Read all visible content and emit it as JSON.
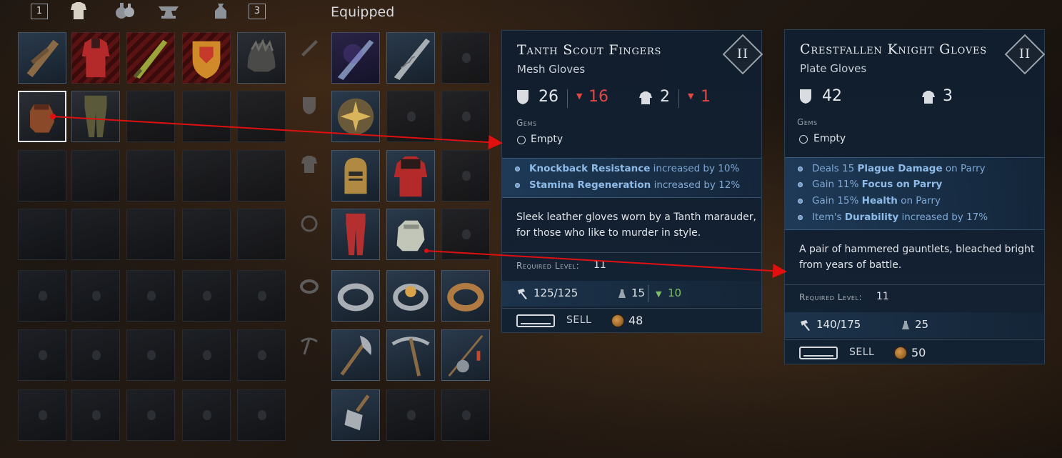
{
  "tabs": {
    "left_key": "1",
    "right_key": "3",
    "icons": [
      "armor-tab-icon",
      "potion-tab-icon",
      "anvil-tab-icon",
      "bag-tab-icon"
    ]
  },
  "equipped_title": "Equipped",
  "compare_left": {
    "name": "Tanth Scout Fingers",
    "type": "Mesh Gloves",
    "tier": "II",
    "armor": "26",
    "armor_diff": "16",
    "weight": "2",
    "weight_diff": "1",
    "gems_label": "Gems",
    "gem_slot": "Empty",
    "perks": [
      {
        "bold": "Knockback Resistance",
        "rest": " increased by 10%"
      },
      {
        "bold": "Stamina Regeneration",
        "rest": " increased by 12%"
      }
    ],
    "description_line1": "Sleek leather gloves worn by a Tanth marauder,",
    "description_line2": "for those who like to murder in style.",
    "required_level_label": "Required Level:",
    "required_level": "11",
    "durability": "125/125",
    "load": "15",
    "load_diff": "10",
    "sell_label": "SELL",
    "price": "48"
  },
  "compare_right": {
    "name": "Crestfallen Knight Gloves",
    "type": "Plate Gloves",
    "tier": "II",
    "armor": "42",
    "weight": "3",
    "gems_label": "Gems",
    "gem_slot": "Empty",
    "perks": [
      {
        "pre": "Deals 15 ",
        "bold": "Plague Damage",
        "rest": " on Parry"
      },
      {
        "pre": "Gain 11% ",
        "bold": "Focus on Parry",
        "rest": ""
      },
      {
        "pre": "Gain 15% ",
        "bold": "Health",
        "rest": " on Parry"
      },
      {
        "pre": "Item's ",
        "bold": "Durability",
        "rest": " increased by 17%"
      }
    ],
    "description_line1": "A pair of hammered gauntlets, bleached bright",
    "description_line2": "from years of battle.",
    "required_level_label": "Required Level:",
    "required_level": "11",
    "durability": "140/175",
    "load": "25",
    "sell_label": "SELL",
    "price": "50"
  },
  "colors": {
    "stat_down": "#e04848",
    "stat_up": "#7fbf6a",
    "perk_text": "#7fa9d6",
    "annotation_arrow": "#e01010"
  }
}
